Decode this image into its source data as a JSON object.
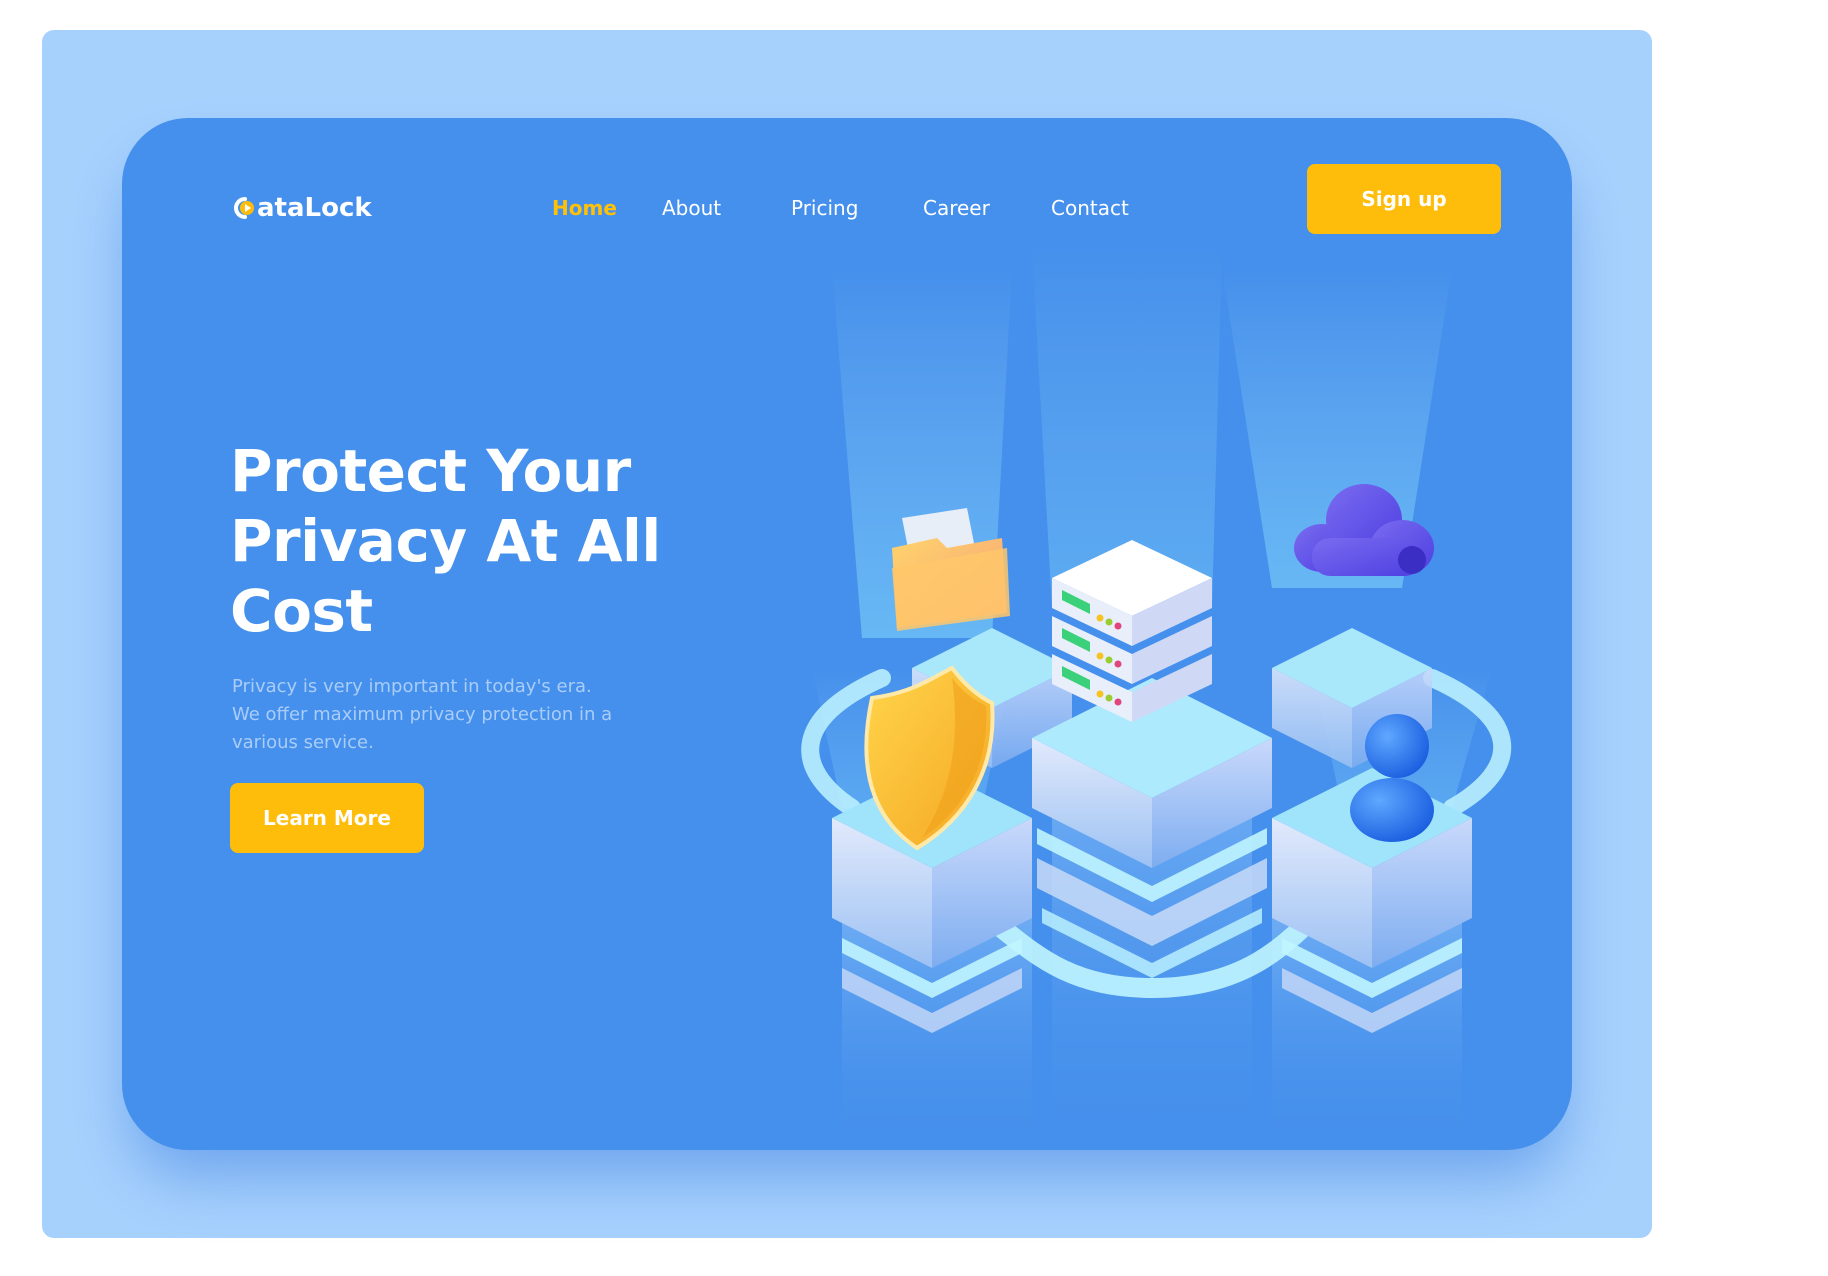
{
  "brand": {
    "name": "ataLock"
  },
  "nav": {
    "items": [
      {
        "label": "Home",
        "active": true
      },
      {
        "label": "About",
        "active": false
      },
      {
        "label": "Pricing",
        "active": false
      },
      {
        "label": "Career",
        "active": false
      },
      {
        "label": "Contact",
        "active": false
      }
    ]
  },
  "header": {
    "signup_label": "Sign up"
  },
  "hero": {
    "headline_lines": [
      "Protect Your",
      "Privacy At All",
      "Cost"
    ],
    "description_lines": [
      "Privacy is very important in today's era.",
      "We offer maximum privacy protection in a",
      "various service."
    ],
    "cta_label": "Learn More"
  },
  "illustration": {
    "icons": [
      "folder-icon",
      "shield-icon",
      "server-icon",
      "cloud-icon",
      "user-icon"
    ]
  },
  "colors": {
    "page_background": "#ffffff",
    "outer_panel": "#a7d1fd",
    "card": "#4590ec",
    "accent": "#ffbd0b",
    "nav_active": "#ffc107",
    "text": "#ffffff",
    "muted_text": "#a9cdf8"
  }
}
